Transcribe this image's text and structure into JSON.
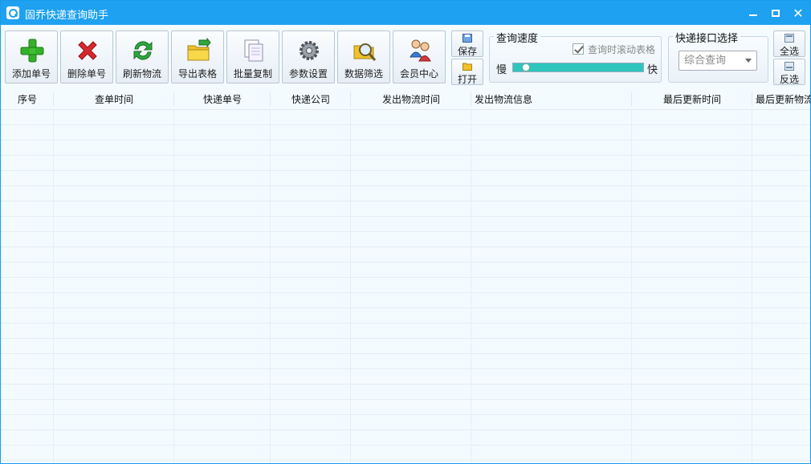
{
  "window": {
    "title": "固乔快递查询助手"
  },
  "titlebar_icons": {
    "minimize": "minimize-icon",
    "maximize": "maximize-icon",
    "close": "close-icon"
  },
  "toolbar": {
    "buttons": [
      {
        "label": "添加单号",
        "icon": "add-icon"
      },
      {
        "label": "删除单号",
        "icon": "delete-icon"
      },
      {
        "label": "刷新物流",
        "icon": "refresh-icon"
      },
      {
        "label": "导出表格",
        "icon": "export-folder-icon"
      },
      {
        "label": "批量复制",
        "icon": "copy-icon"
      },
      {
        "label": "参数设置",
        "icon": "gear-icon"
      },
      {
        "label": "数据筛选",
        "icon": "filter-search-icon"
      },
      {
        "label": "会员中心",
        "icon": "members-icon"
      }
    ],
    "save_label": "保存",
    "open_label": "打开"
  },
  "speed_group": {
    "title": "查询速度",
    "scroll_checkbox_label": "查询时滚动表格",
    "scroll_checked": true,
    "slow_label": "慢",
    "fast_label": "快",
    "speed_fraction": 0.05
  },
  "api_group": {
    "title": "快递接口选择",
    "selected": "综合查询"
  },
  "select_buttons": {
    "select_all": "全选",
    "invert": "反选"
  },
  "table": {
    "columns": [
      "序号",
      "查单时间",
      "快递单号",
      "快递公司",
      "发出物流时间",
      "发出物流信息",
      "最后更新时间",
      "最后更新物流"
    ]
  },
  "colors": {
    "titlebar": "#1ea1f0",
    "slider_fill": "#2ec5bd"
  }
}
